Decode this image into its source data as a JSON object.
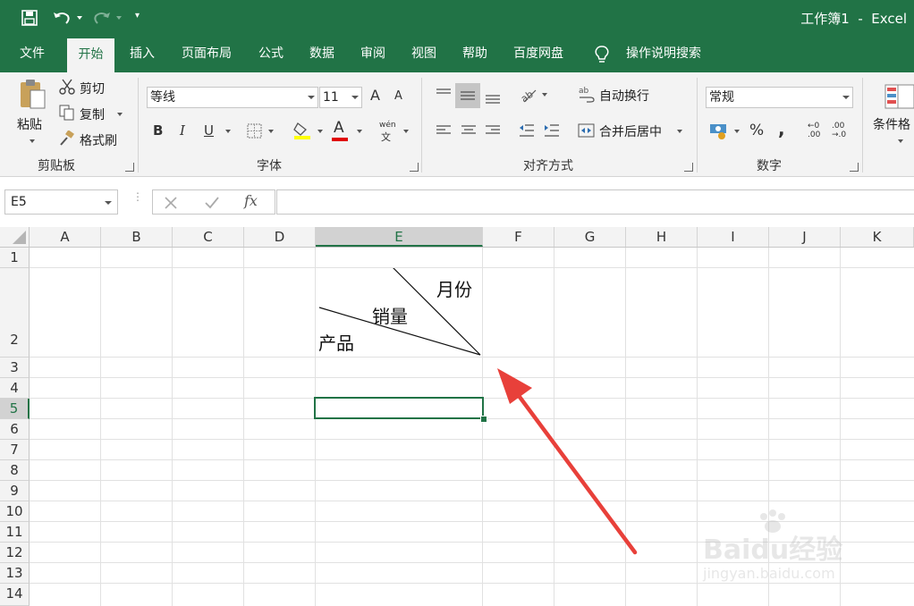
{
  "titlebar": {
    "title": "工作簿1  -  Excel",
    "colors": {
      "ribbon_green": "#217346",
      "accent_red": "#e8403a"
    },
    "quick_access": [
      "save-icon",
      "undo-icon",
      "redo-icon",
      "customize-icon"
    ]
  },
  "tabs": [
    "文件",
    "开始",
    "插入",
    "页面布局",
    "公式",
    "数据",
    "审阅",
    "视图",
    "帮助",
    "百度网盘",
    "操作说明搜索"
  ],
  "ribbon": {
    "clipboard": {
      "paste": "粘贴",
      "cut": "剪切",
      "copy": "复制",
      "format_painter": "格式刷",
      "group": "剪贴板"
    },
    "font": {
      "name": "等线",
      "size": "11",
      "group": "字体",
      "bold": "B",
      "italic": "I",
      "underline": "U",
      "grow": "A",
      "shrink": "A",
      "font_color": "A",
      "phonetic_top": "wén",
      "phonetic_bottom": "文"
    },
    "alignment": {
      "wrap": "自动换行",
      "merge": "合并后居中",
      "group": "对齐方式"
    },
    "number": {
      "format": "常规",
      "percent": "%",
      "comma": ",",
      "inc_top": "←0",
      "inc_bottom": ".00",
      "dec_top": ".00",
      "dec_bottom": "→.0",
      "group": "数字"
    },
    "styles": {
      "conditional": "条件格"
    }
  },
  "formula_bar": {
    "name_box": "E5",
    "fx": "fx",
    "value": ""
  },
  "columns": [
    "A",
    "B",
    "C",
    "D",
    "E",
    "F",
    "G",
    "H",
    "I",
    "J",
    "K"
  ],
  "rows": [
    "1",
    "2",
    "3",
    "4",
    "5",
    "6",
    "7",
    "8",
    "9",
    "10",
    "11",
    "12",
    "13",
    "14"
  ],
  "cell_E2": {
    "month": "月份",
    "sales": "销量",
    "product": "产品"
  },
  "selected_cell": "E5",
  "watermark": {
    "brand": "Baidu经验",
    "url": "jingyan.baidu.com"
  }
}
